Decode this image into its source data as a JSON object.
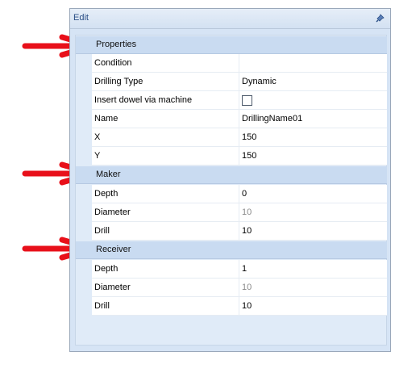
{
  "panel": {
    "title": "Edit",
    "pin_icon": "pin-icon"
  },
  "categories": [
    {
      "label": "Properties",
      "rows": [
        {
          "name": "Condition",
          "value": ""
        },
        {
          "name": "Drilling Type",
          "value": "Dynamic"
        },
        {
          "name": "Insert dowel via machine",
          "value": "",
          "checkbox": true,
          "checked": false
        },
        {
          "name": "Name",
          "value": "DrillingName01"
        },
        {
          "name": "X",
          "value": "150"
        },
        {
          "name": "Y",
          "value": "150"
        }
      ]
    },
    {
      "label": "Maker",
      "rows": [
        {
          "name": "Depth",
          "value": "0"
        },
        {
          "name": "Diameter",
          "value": "10",
          "dim": true
        },
        {
          "name": "Drill",
          "value": "10"
        }
      ]
    },
    {
      "label": "Receiver",
      "rows": [
        {
          "name": "Depth",
          "value": "1"
        },
        {
          "name": "Diameter",
          "value": "10",
          "dim": true
        },
        {
          "name": "Drill",
          "value": "10"
        }
      ]
    }
  ],
  "annotation_color": "#e8101a"
}
